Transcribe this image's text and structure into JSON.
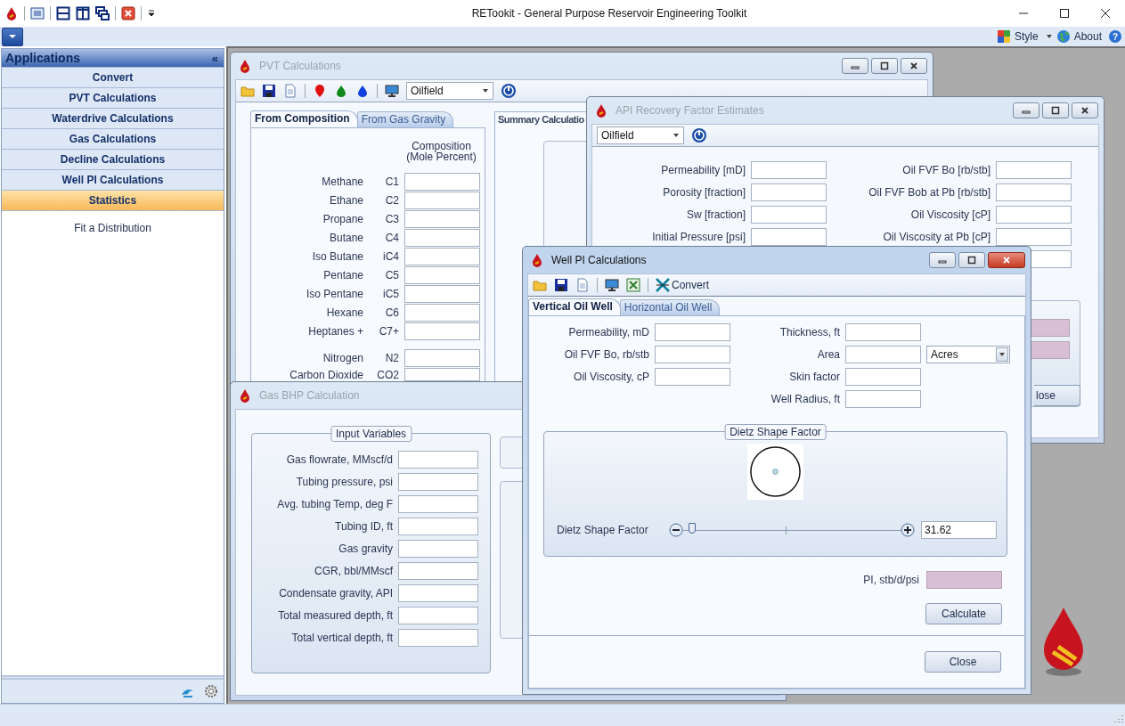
{
  "window": {
    "title": "RETookit - General Purpose Reservoir Engineering Toolkit"
  },
  "menu": {
    "style": "Style",
    "about": "About",
    "help": "?"
  },
  "sidebar": {
    "header": "Applications",
    "collapse": "«",
    "items": [
      {
        "label": "Convert",
        "selected": false
      },
      {
        "label": "PVT Calculations",
        "selected": false
      },
      {
        "label": "Waterdrive Calculations",
        "selected": false
      },
      {
        "label": "Gas Calculations",
        "selected": false
      },
      {
        "label": "Decline Calculations",
        "selected": false
      },
      {
        "label": "Well PI Calculations",
        "selected": false
      },
      {
        "label": "Statistics",
        "selected": true
      }
    ],
    "links": [
      "Fit a Distribution"
    ]
  },
  "pvt": {
    "title": "PVT Calculations",
    "active": false,
    "units": "Oilfield",
    "tabs": [
      {
        "label": "From Composition",
        "selected": true
      },
      {
        "label": "From Gas Gravity",
        "selected": false
      }
    ],
    "composition_header": "Composition\n(Mole Percent)",
    "components": [
      {
        "name": "Methane",
        "code": "C1"
      },
      {
        "name": "Ethane",
        "code": "C2"
      },
      {
        "name": "Propane",
        "code": "C3"
      },
      {
        "name": "Butane",
        "code": "C4"
      },
      {
        "name": "Iso Butane",
        "code": "iC4"
      },
      {
        "name": "Pentane",
        "code": "C5"
      },
      {
        "name": "Iso Pentane",
        "code": "iC5"
      },
      {
        "name": "Hexane",
        "code": "C6"
      },
      {
        "name": "Heptanes +",
        "code": "C7+"
      }
    ],
    "gases": [
      {
        "name": "Nitrogen",
        "code": "N2"
      },
      {
        "name": "Carbon Dioxide",
        "code": "CO2"
      }
    ],
    "summary_title": "Summary Calculatio"
  },
  "gas_bhp": {
    "title": "Gas BHP Calculation",
    "active": false,
    "group": "Input Variables",
    "fields": [
      "Gas flowrate, MMscf/d",
      "Tubing pressure, psi",
      "Avg. tubing Temp, deg F",
      "Tubing ID, ft",
      "Gas gravity",
      "CGR, bbl/MMscf",
      "Condensate gravity, API",
      "Total measured depth, ft",
      "Total vertical depth, ft"
    ]
  },
  "api": {
    "title": "API Recovery Factor Estimates",
    "active": false,
    "units": "Oilfield",
    "left_fields": [
      "Permeability [mD]",
      "Porosity [fraction]",
      "Sw [fraction]",
      "Initial Pressure [psi]"
    ],
    "right_fields": [
      "Oil FVF Bo [rb/stb]",
      "Oil FVF Bob at Pb [rb/stb]",
      "Oil Viscosity [cP]",
      "Oil Viscosity  at Pb [cP]"
    ],
    "close": "lose"
  },
  "well_pi": {
    "title": "Well PI Calculations",
    "active": true,
    "convert": "Convert",
    "tabs": [
      {
        "label": "Vertical Oil Well",
        "selected": true
      },
      {
        "label": "Horizontal Oil Well",
        "selected": false
      }
    ],
    "left_fields": [
      "Permeability, mD",
      "Oil FVF Bo, rb/stb",
      "Oil Viscosity, cP"
    ],
    "right_fields": [
      "Thickness, ft",
      "Area",
      "Skin factor",
      "Well Radius, ft"
    ],
    "area_unit": "Acres",
    "group": "Dietz Shape Factor",
    "slider": {
      "label": "Dietz Shape Factor",
      "level": 0.03,
      "value": "31.62"
    },
    "pi_label": "PI, stb/d/psi",
    "calculate": "Calculate",
    "close": "Close"
  }
}
